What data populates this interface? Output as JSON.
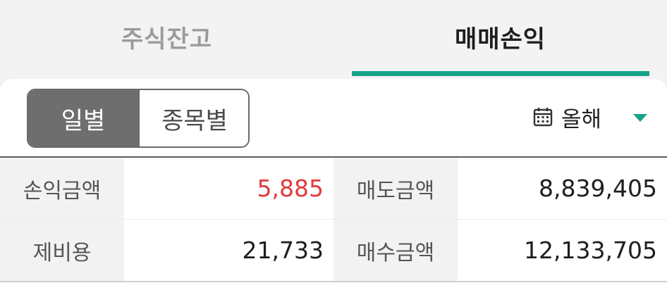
{
  "tabs": [
    {
      "label": "주식잔고",
      "active": false
    },
    {
      "label": "매매손익",
      "active": true
    }
  ],
  "accent_color": "#15a38a",
  "segment": {
    "options": [
      "일별",
      "종목별"
    ],
    "selected": "일별"
  },
  "period": {
    "icon": "calendar-icon",
    "label": "올해",
    "dropdown_icon": "caret-down-icon"
  },
  "summary": {
    "profit_label": "손익금액",
    "profit_value": "5,885",
    "profit_color": "#e23b3b",
    "sell_label": "매도금액",
    "sell_value": "8,839,405",
    "fee_label": "제비용",
    "fee_value": "21,733",
    "buy_label": "매수금액",
    "buy_value": "12,133,705"
  }
}
